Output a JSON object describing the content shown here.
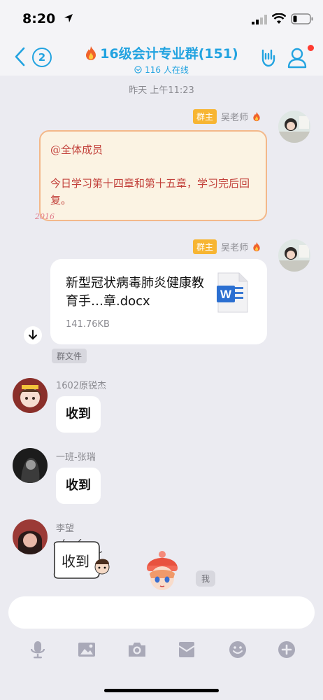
{
  "status": {
    "time": "8:20"
  },
  "header": {
    "back_count": "2",
    "title": "16级会计专业群(151)",
    "online": "116 人在线"
  },
  "chat": {
    "timestamp": "昨天 上午11:23",
    "messages": [
      {
        "sender": "吴老师",
        "tag": "群主",
        "type": "note",
        "line1": "@全体成员",
        "line2": "今日学习第十四章和第十五章，学习完后回复。",
        "sticker_text": "2016"
      },
      {
        "sender": "吴老师",
        "tag": "群主",
        "type": "file",
        "file_name": "新型冠状病毒肺炎健康教育手…章.docx",
        "file_size": "141.76KB",
        "file_tag": "群文件"
      },
      {
        "sender": "1602原锐杰",
        "type": "text",
        "text": "收到"
      },
      {
        "sender": "一班-张瑞",
        "type": "text",
        "text": "收到"
      },
      {
        "sender": "李望",
        "type": "sticker",
        "sticker_text": "收到"
      }
    ],
    "me_tag": "我"
  },
  "colors": {
    "accent": "#22a3e0",
    "owner_tag": "#f7b532",
    "icon_gray": "#a9a9b8"
  },
  "toolbar": [
    "microphone-icon",
    "image-icon",
    "camera-icon",
    "red-packet-icon",
    "emoji-icon",
    "plus-icon"
  ]
}
